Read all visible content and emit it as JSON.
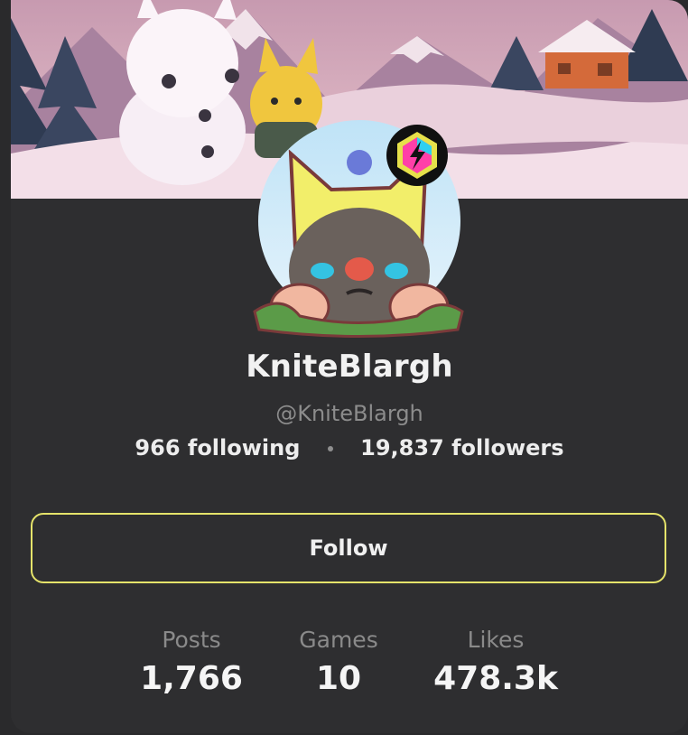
{
  "profile": {
    "display_name": "KniteBlargh",
    "handle": "@KniteBlargh",
    "following": "966 following",
    "followers": "19,837 followers"
  },
  "actions": {
    "follow_label": "Follow"
  },
  "metrics": [
    {
      "label": "Posts",
      "value": "1,766"
    },
    {
      "label": "Games",
      "value": "10"
    },
    {
      "label": "Likes",
      "value": "478.3k"
    }
  ],
  "colors": {
    "card_bg": "#2e2e30",
    "follow_border": "#e5e36a",
    "text_primary": "#f2f2f2",
    "text_secondary": "#8c8c8c"
  },
  "icons": {
    "banner": "snowy-village-artwork",
    "avatar": "mole-with-cat-hat-avatar",
    "badge": "lightning-hexagon-badge-icon",
    "separator": "dot-separator-icon"
  }
}
